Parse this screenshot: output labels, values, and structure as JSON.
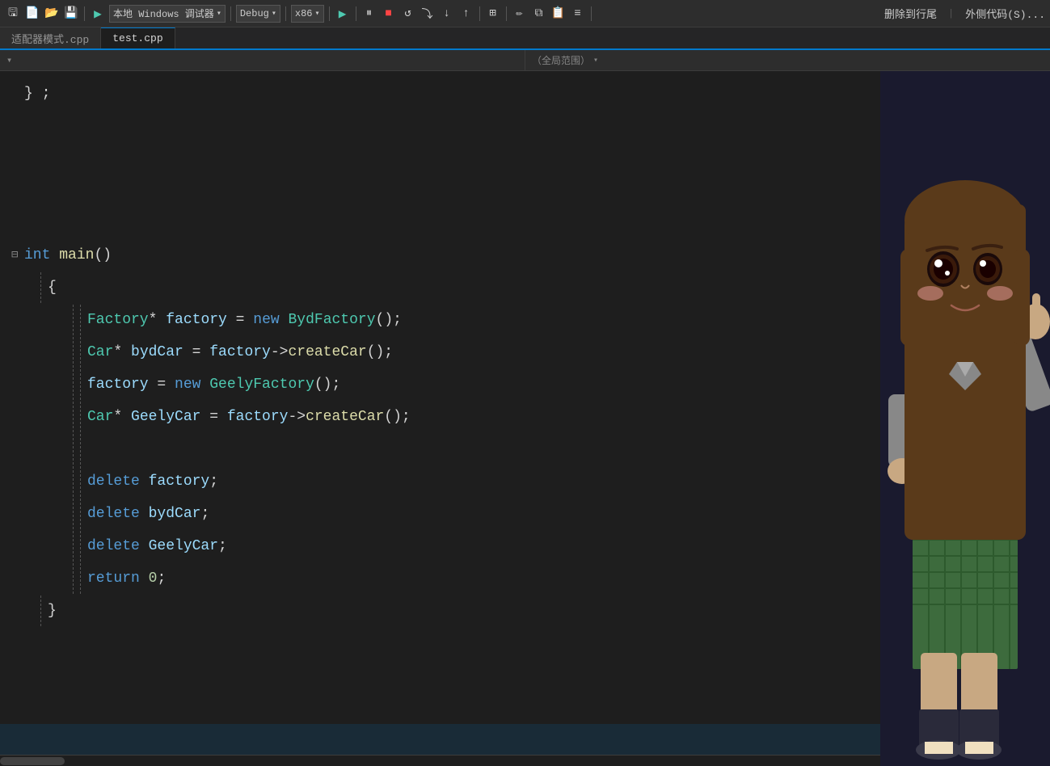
{
  "toolbar": {
    "save_icon": "💾",
    "config_label": "本地 Windows 调试器",
    "debug_label": "Debug",
    "arch_label": "x86",
    "delete_to_end": "删除到行尾",
    "outer_code": "外侧代码(S)..."
  },
  "tabs": [
    {
      "label": "适配器模式.cpp",
      "active": false
    },
    {
      "label": "test.cpp",
      "active": true
    }
  ],
  "scope": {
    "left": "",
    "right": "（全局范围）"
  },
  "code": {
    "closing_brace": "} ;",
    "main_sig": "int main()",
    "open_brace": "{",
    "lines": [
      "    Factory* factory = new BydFactory();",
      "    Car* bydCar = factory->createCar();",
      "    factory = new GeelyFactory();",
      "    Car* GeelyCar = factory->createCar();",
      "",
      "    delete factory;",
      "    delete bydCar;",
      "    delete GeelyCar;",
      "    return 0;",
      "}"
    ]
  }
}
